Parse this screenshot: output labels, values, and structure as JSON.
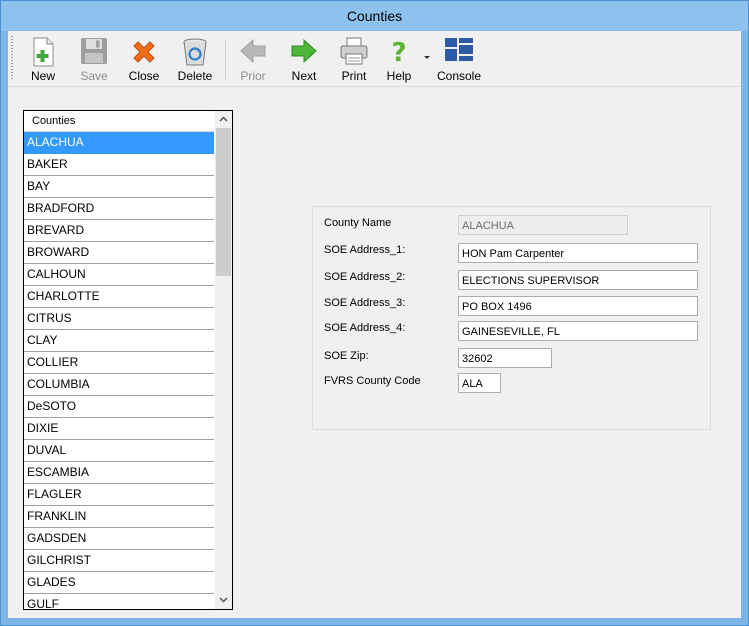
{
  "window": {
    "title": "Counties"
  },
  "toolbar": {
    "new": "New",
    "save": "Save",
    "close": "Close",
    "delete": "Delete",
    "prior": "Prior",
    "next": "Next",
    "print": "Print",
    "help": "Help",
    "console": "Console"
  },
  "list": {
    "header": "Counties",
    "selected": "ALACHUA",
    "items": [
      "ALACHUA",
      "BAKER",
      "BAY",
      "BRADFORD",
      "BREVARD",
      "BROWARD",
      "CALHOUN",
      "CHARLOTTE",
      "CITRUS",
      "CLAY",
      "COLLIER",
      "COLUMBIA",
      "DeSOTO",
      "DIXIE",
      "DUVAL",
      "ESCAMBIA",
      "FLAGLER",
      "FRANKLIN",
      "GADSDEN",
      "GILCHRIST",
      "GLADES",
      "GULF"
    ]
  },
  "form": {
    "county_name": {
      "label": "County Name",
      "value": "ALACHUA"
    },
    "address1": {
      "label": "SOE Address_1:",
      "value": "HON Pam Carpenter"
    },
    "address2": {
      "label": "SOE Address_2:",
      "value": "ELECTIONS SUPERVISOR"
    },
    "address3": {
      "label": "SOE Address_3:",
      "value": "PO BOX 1496"
    },
    "address4": {
      "label": "SOE Address_4:",
      "value": "GAINESEVILLE, FL"
    },
    "zip": {
      "label": "SOE Zip:",
      "value": "32602"
    },
    "county_code": {
      "label": "FVRS County Code",
      "value": "ALA"
    }
  },
  "colors": {
    "selection": "#3399ff",
    "titlebar": "#8fc1ee",
    "frame": "#7fb4e6"
  }
}
